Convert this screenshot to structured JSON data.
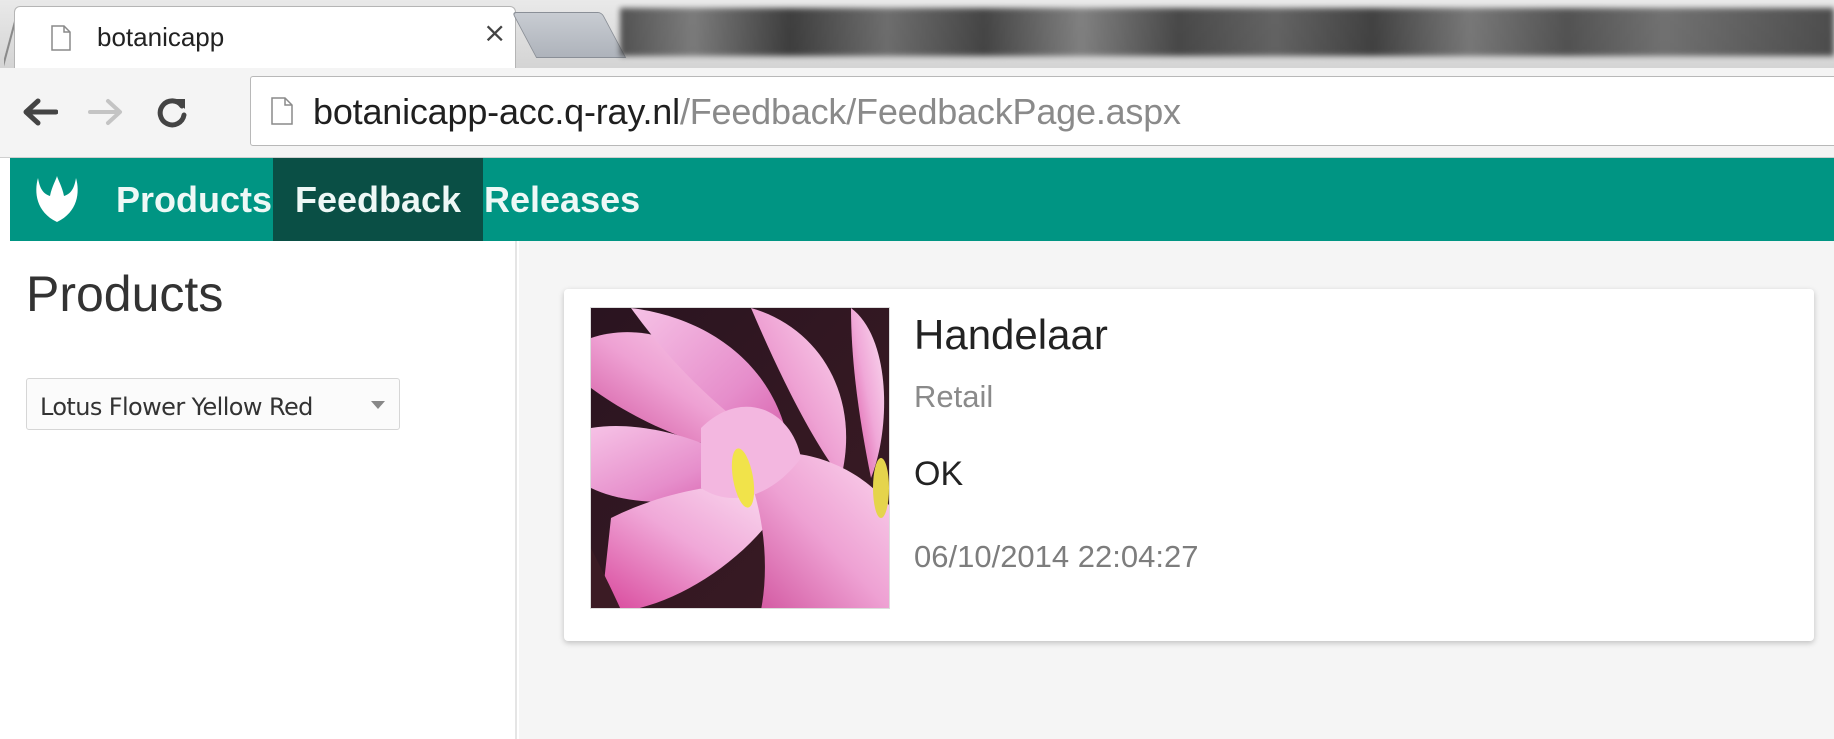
{
  "browser": {
    "tab": {
      "title": "botanicapp",
      "close_glyph": "×",
      "icon": "page-icon"
    },
    "address_bar": {
      "host": "botanicapp-acc.q-ray.nl",
      "path": "/Feedback/FeedbackPage.aspx"
    },
    "nav_buttons": {
      "back": "back-arrow-icon",
      "forward": "forward-arrow-icon",
      "reload": "reload-icon"
    }
  },
  "app": {
    "logo": "tulip-logo-icon",
    "nav": [
      {
        "label": "Products",
        "active": false
      },
      {
        "label": "Feedback",
        "active": true
      },
      {
        "label": "Releases",
        "active": false
      }
    ],
    "colors": {
      "navbar": "#009583",
      "navbar_active": "#0a4f45"
    }
  },
  "sidebar": {
    "heading": "Products",
    "product_select": {
      "selected": "Lotus Flower Yellow Red"
    }
  },
  "feedback_card": {
    "name": "Handelaar",
    "role": "Retail",
    "text": "OK",
    "date": "06/10/2014 22:04:27",
    "image": "lotus-flower-photo"
  }
}
